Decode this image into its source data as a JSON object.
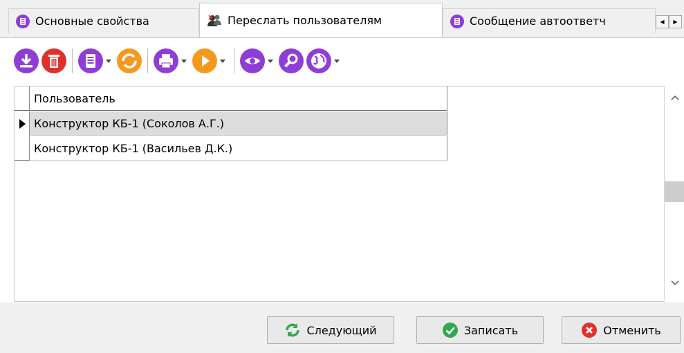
{
  "tabs": [
    {
      "label": "Основные свойства",
      "icon": "document-icon",
      "active": false
    },
    {
      "label": "Переслать пользователям",
      "icon": "users-icon",
      "active": true
    },
    {
      "label": "Сообщение автоответч",
      "icon": "document-icon",
      "active": false
    }
  ],
  "toolbar": [
    {
      "name": "download-icon"
    },
    {
      "name": "delete-icon"
    },
    {
      "name": "document-icon",
      "dropdown": true
    },
    {
      "name": "refresh-icon"
    },
    {
      "name": "print-icon",
      "dropdown": true
    },
    {
      "name": "play-icon",
      "dropdown": true
    },
    {
      "name": "eye-icon",
      "dropdown": true
    },
    {
      "name": "search-icon"
    },
    {
      "name": "globe-icon",
      "dropdown": true
    }
  ],
  "grid": {
    "column_header": "Пользователь",
    "rows": [
      "Конструктор КБ-1 (Соколов А.Г.)",
      "Конструктор КБ-1 (Васильев Д.К.)"
    ],
    "selected_row": 0
  },
  "buttons": {
    "next": "Следующий",
    "save": "Записать",
    "cancel": "Отменить"
  },
  "colors": {
    "purple": "#8e3ed6",
    "red": "#e0302b",
    "orange": "#f39a1e",
    "green": "#2fa84f"
  }
}
